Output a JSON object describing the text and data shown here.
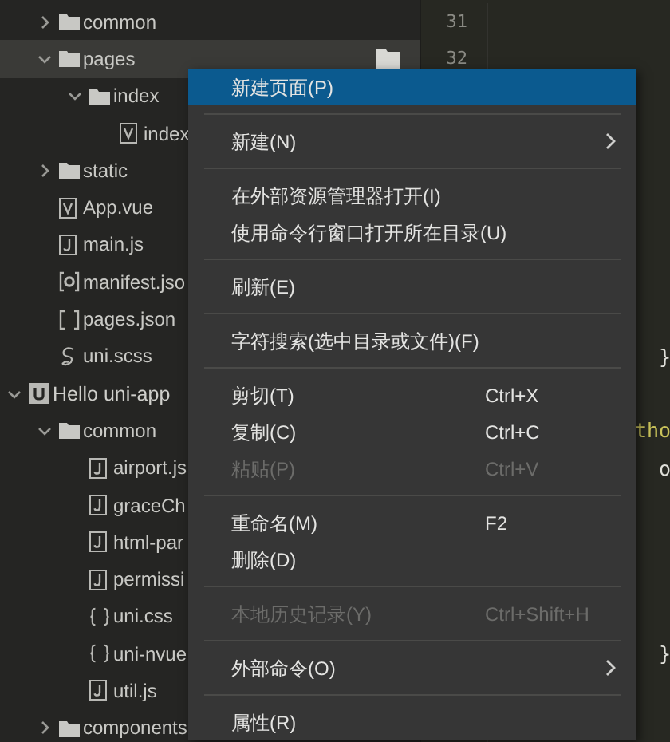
{
  "projects": [
    {
      "items": [
        {
          "label": "common",
          "kind": "folder",
          "expanded": false,
          "selected": false
        },
        {
          "label": "pages",
          "kind": "folder",
          "expanded": true,
          "selected": true,
          "children": [
            {
              "label": "index",
              "kind": "folder",
              "expanded": true,
              "selected": false,
              "children": [
                {
                  "label": "index",
                  "kind": "vue",
                  "selected": false
                }
              ]
            }
          ]
        },
        {
          "label": "static",
          "kind": "folder",
          "expanded": false,
          "selected": false
        },
        {
          "label": "App.vue",
          "kind": "vue",
          "selected": false
        },
        {
          "label": "main.js",
          "kind": "js",
          "selected": false
        },
        {
          "label": "manifest.jso",
          "kind": "manifest",
          "selected": false
        },
        {
          "label": "pages.json",
          "kind": "brackets",
          "selected": false
        },
        {
          "label": "uni.scss",
          "kind": "scss",
          "selected": false
        }
      ]
    },
    {
      "name": "Hello uni-app",
      "items": [
        {
          "label": "common",
          "kind": "folder",
          "expanded": true,
          "selected": false,
          "children": [
            {
              "label": "airport.js",
              "kind": "js",
              "selected": false
            },
            {
              "label": "graceCh",
              "kind": "js",
              "selected": false
            },
            {
              "label": "html-par",
              "kind": "js",
              "selected": false
            },
            {
              "label": "permissi",
              "kind": "js",
              "selected": false
            },
            {
              "label": "uni.css",
              "kind": "css",
              "selected": false
            },
            {
              "label": "uni-nvue",
              "kind": "css",
              "selected": false
            },
            {
              "label": "util.js",
              "kind": "js",
              "selected": false
            }
          ]
        },
        {
          "label": "components",
          "kind": "folder",
          "expanded": false,
          "selected": false
        }
      ]
    }
  ],
  "editor": {
    "lines": [
      {
        "kind": "blank",
        "number": "31"
      },
      {
        "kind": "blank",
        "number": "32"
      },
      {
        "kind": "blank"
      },
      {
        "kind": "blank"
      },
      {
        "kind": "blank"
      },
      {
        "kind": "blank"
      },
      {
        "kind": "blank"
      },
      {
        "kind": "blank"
      },
      {
        "kind": "blank"
      },
      {
        "kind": "plain",
        "code": "}",
        "indent": true
      },
      {
        "kind": "blank"
      },
      {
        "kind": "name",
        "code": "tho",
        "indent": false
      },
      {
        "kind": "plain",
        "code": "o",
        "indent": true
      },
      {
        "kind": "blank"
      },
      {
        "kind": "blank"
      },
      {
        "kind": "blank"
      },
      {
        "kind": "blank"
      },
      {
        "kind": "plain",
        "code": "}",
        "indent": true
      }
    ]
  },
  "context_menu": [
    {
      "kind": "item",
      "label": "新建页面(P)",
      "selected": true,
      "disabled": false
    },
    {
      "kind": "separator"
    },
    {
      "kind": "item",
      "label": "新建(N)",
      "submenu": true,
      "selected": false,
      "disabled": false
    },
    {
      "kind": "separator"
    },
    {
      "kind": "item",
      "label": "在外部资源管理器打开(I)",
      "selected": false,
      "disabled": false
    },
    {
      "kind": "item",
      "label": "使用命令行窗口打开所在目录(U)",
      "selected": false,
      "disabled": false
    },
    {
      "kind": "separator"
    },
    {
      "kind": "item",
      "label": "刷新(E)",
      "selected": false,
      "disabled": false
    },
    {
      "kind": "separator"
    },
    {
      "kind": "item",
      "label": "字符搜索(选中目录或文件)(F)",
      "selected": false,
      "disabled": false
    },
    {
      "kind": "separator"
    },
    {
      "kind": "item",
      "label": "剪切(T)",
      "shortcut": "Ctrl+X",
      "selected": false,
      "disabled": false
    },
    {
      "kind": "item",
      "label": "复制(C)",
      "shortcut": "Ctrl+C",
      "selected": false,
      "disabled": false
    },
    {
      "kind": "item",
      "label": "粘贴(P)",
      "shortcut": "Ctrl+V",
      "selected": false,
      "disabled": true
    },
    {
      "kind": "separator"
    },
    {
      "kind": "item",
      "label": "重命名(M)",
      "shortcut": "F2",
      "selected": false,
      "disabled": false
    },
    {
      "kind": "item",
      "label": "删除(D)",
      "selected": false,
      "disabled": false
    },
    {
      "kind": "separator"
    },
    {
      "kind": "item",
      "label": "本地历史记录(Y)",
      "shortcut": "Ctrl+Shift+H",
      "selected": false,
      "disabled": true
    },
    {
      "kind": "separator"
    },
    {
      "kind": "item",
      "label": "外部命令(O)",
      "submenu": true,
      "selected": false,
      "disabled": false
    },
    {
      "kind": "separator"
    },
    {
      "kind": "item",
      "label": "属性(R)",
      "selected": false,
      "disabled": false
    }
  ]
}
